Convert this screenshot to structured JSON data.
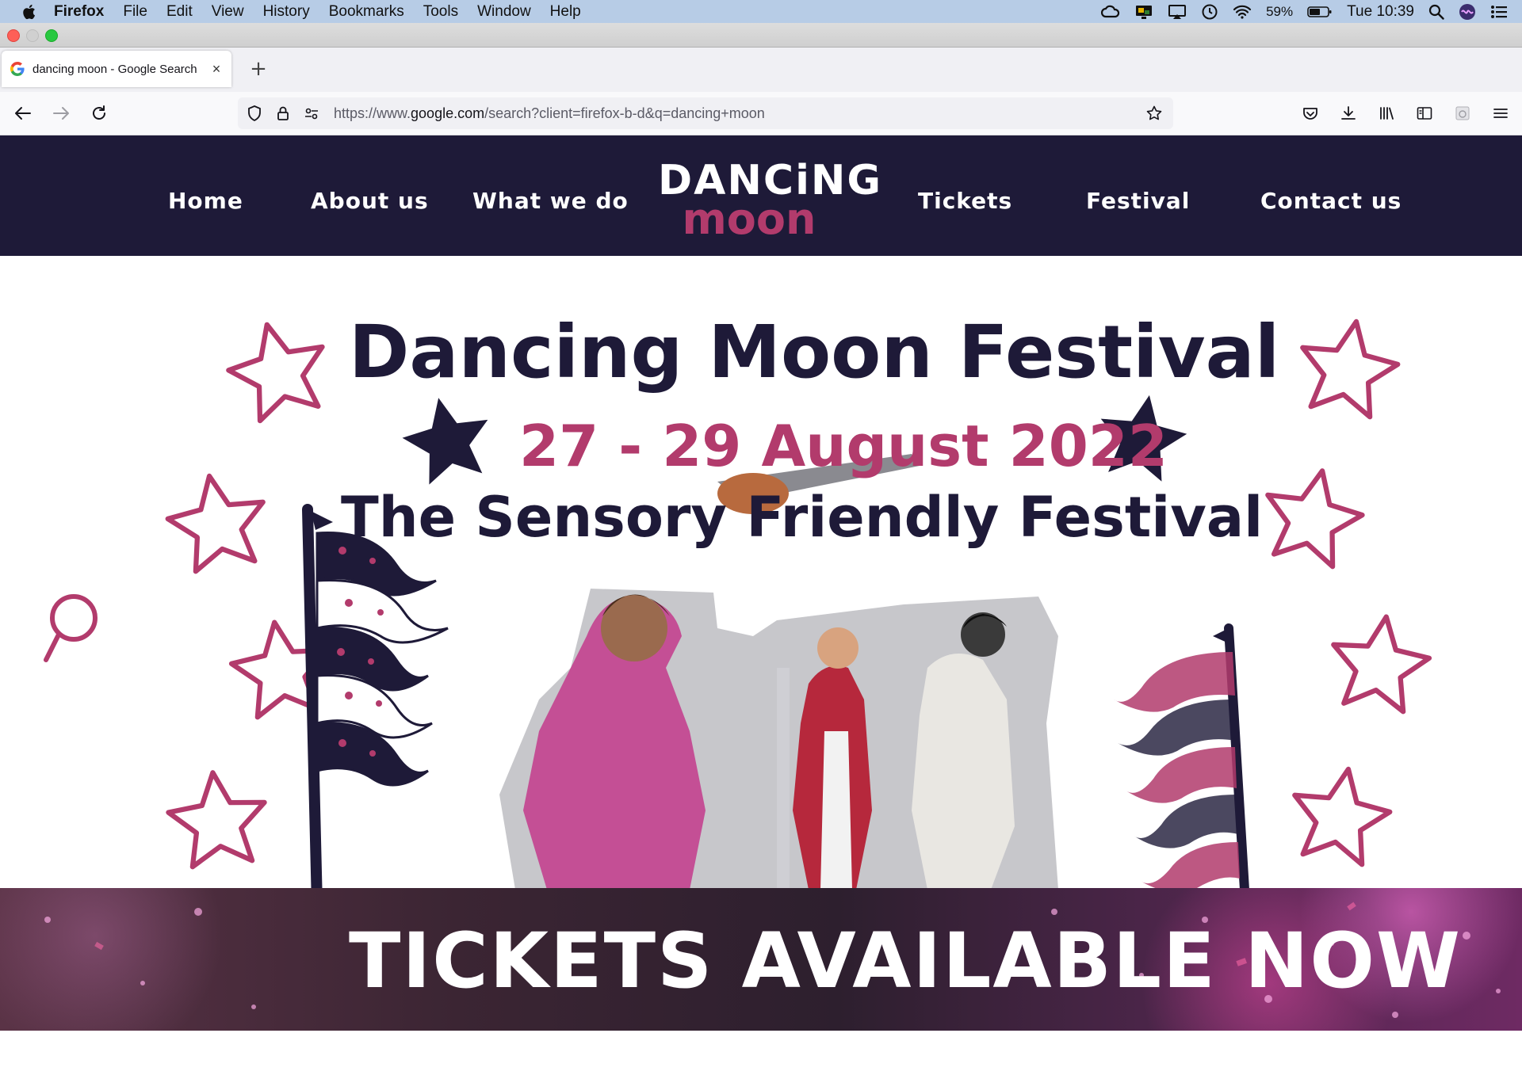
{
  "menubar": {
    "app": "Firefox",
    "items": [
      "File",
      "Edit",
      "View",
      "History",
      "Bookmarks",
      "Tools",
      "Window",
      "Help"
    ],
    "battery": "59%",
    "clock": "Tue 10:39"
  },
  "tab": {
    "title": "dancing moon - Google Search",
    "close": "×",
    "new_tab": "+"
  },
  "urlbar": {
    "prefix": "https://www.",
    "domain": "google.com",
    "suffix": "/search?client=firefox-b-d&q=dancing+moon"
  },
  "site": {
    "nav_left": [
      "Home",
      "About us",
      "What we do"
    ],
    "nav_right": [
      "Tickets",
      "Festival",
      "Contact us"
    ],
    "logo_line1": "DANCiNG",
    "logo_line2": "moon"
  },
  "hero": {
    "title": "Dancing Moon Festival",
    "dates": "27 - 29 August 2022",
    "subtitle": "The Sensory Friendly Festival",
    "banner": "TICKETS AVAILABLE NOW"
  },
  "colors": {
    "navy": "#1e1a38",
    "magenta": "#b23b6c",
    "menubar": "#b7cce6"
  }
}
